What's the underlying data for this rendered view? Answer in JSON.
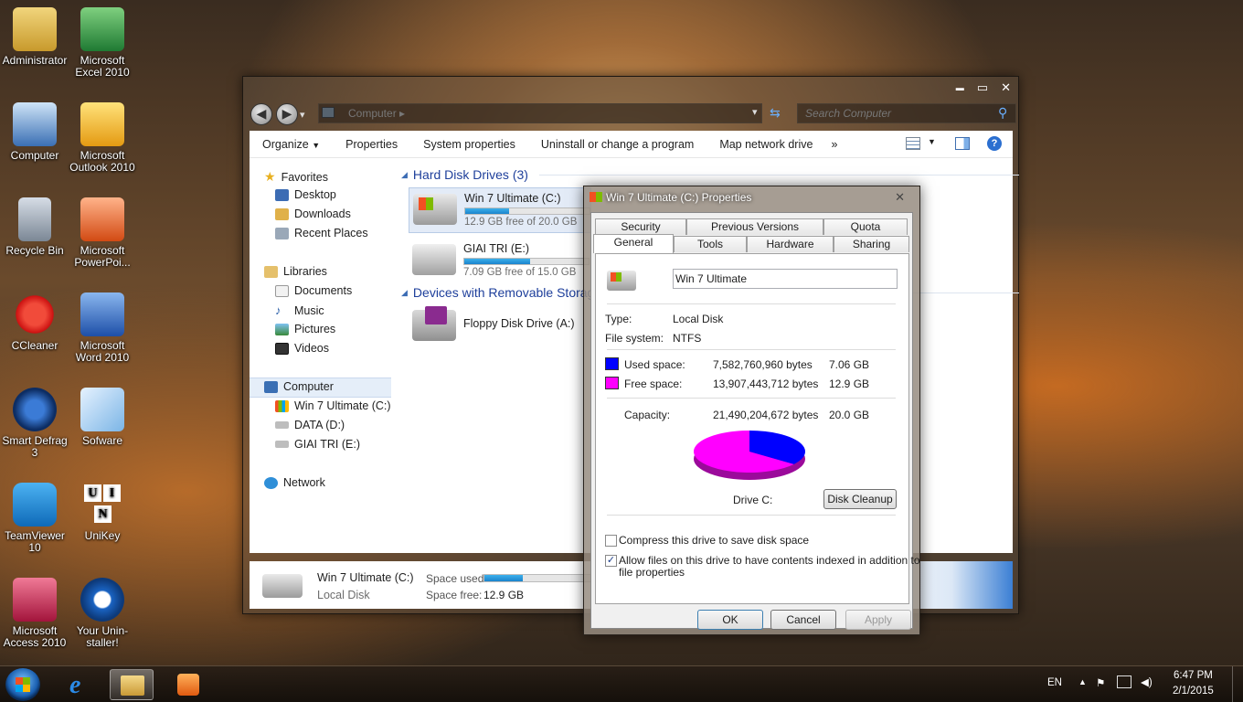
{
  "desktop": {
    "icons": [
      {
        "label": "Administrator"
      },
      {
        "label": "Microsoft Excel 2010"
      },
      {
        "label": "Computer"
      },
      {
        "label": "Microsoft Outlook 2010"
      },
      {
        "label": "Recycle Bin"
      },
      {
        "label": "Microsoft PowerPoi..."
      },
      {
        "label": "CCleaner"
      },
      {
        "label": "Microsoft Word 2010"
      },
      {
        "label": "Smart Defrag 3"
      },
      {
        "label": "Sofware"
      },
      {
        "label": "TeamViewer 10"
      },
      {
        "label": "UniKey"
      },
      {
        "label": "Microsoft Access 2010"
      },
      {
        "label": "Your Unin-staller!"
      }
    ],
    "unikey_letters": [
      "U",
      "I",
      "N"
    ]
  },
  "explorer": {
    "controls": {
      "minimize": "▬",
      "maximize": "▭",
      "close": "✕"
    },
    "nav": {
      "back": "◀",
      "forward": "▶",
      "recent": "▾"
    },
    "address": "Computer  ▸",
    "search_placeholder": "Search Computer",
    "toolbar": {
      "organize": "Organize",
      "properties": "Properties",
      "system_properties": "System properties",
      "uninstall": "Uninstall or change a program",
      "map_network": "Map network drive",
      "more": "»"
    },
    "navpane": {
      "favorites": "Favorites",
      "desktop": "Desktop",
      "downloads": "Downloads",
      "recent_places": "Recent Places",
      "libraries": "Libraries",
      "documents": "Documents",
      "music": "Music",
      "pictures": "Pictures",
      "videos": "Videos",
      "computer": "Computer",
      "drive_c": "Win 7 Ultimate (C:)",
      "drive_d": "DATA (D:)",
      "drive_e": "GIAI TRI (E:)",
      "network": "Network"
    },
    "groups": {
      "hdd": "Hard Disk Drives (3)",
      "removable": "Devices with Removable Storag"
    },
    "drives": [
      {
        "name": "Win 7 Ultimate (C:)",
        "free": "12.9 GB free of 20.0 GB",
        "used_fraction": 0.355
      },
      {
        "name": "GIAI TRI (E:)",
        "free": "7.09 GB free of 15.0 GB",
        "used_fraction": 0.527
      }
    ],
    "floppy": "Floppy Disk Drive (A:)",
    "details": {
      "name": "Win 7 Ultimate (C:)",
      "type": "Local Disk",
      "space_used_label": "Space used:",
      "space_free_label": "Space free:",
      "space_free": "12.9 GB",
      "used_fraction": 0.355
    }
  },
  "properties": {
    "title": "Win 7 Ultimate (C:) Properties",
    "close": "✕",
    "tabs_top": [
      "Security",
      "Previous Versions",
      "Quota"
    ],
    "tabs_bottom": [
      "General",
      "Tools",
      "Hardware",
      "Sharing"
    ],
    "label_value": "Win 7 Ultimate",
    "type_label": "Type:",
    "type_value": "Local Disk",
    "fs_label": "File system:",
    "fs_value": "NTFS",
    "used_label": "Used space:",
    "used_bytes": "7,582,760,960 bytes",
    "used_gb": "7.06 GB",
    "free_label": "Free space:",
    "free_bytes": "13,907,443,712 bytes",
    "free_gb": "12.9 GB",
    "capacity_label": "Capacity:",
    "capacity_bytes": "21,490,204,672 bytes",
    "capacity_gb": "20.0 GB",
    "drive_caption": "Drive C:",
    "disk_cleanup": "Disk Cleanup",
    "compress_label": "Compress this drive to save disk space",
    "compress_checked": false,
    "index_label_1": "Allow files on this drive to have contents indexed in addition to",
    "index_label_2": "file properties",
    "index_checked": true,
    "check_mark": "✓",
    "ok": "OK",
    "cancel": "Cancel",
    "apply": "Apply",
    "colors": {
      "used": "#0000ff",
      "free": "#ff00ff"
    },
    "used_fraction": 0.3528
  },
  "taskbar": {
    "language": "EN",
    "time": "6:47 PM",
    "date": "2/1/2015"
  }
}
